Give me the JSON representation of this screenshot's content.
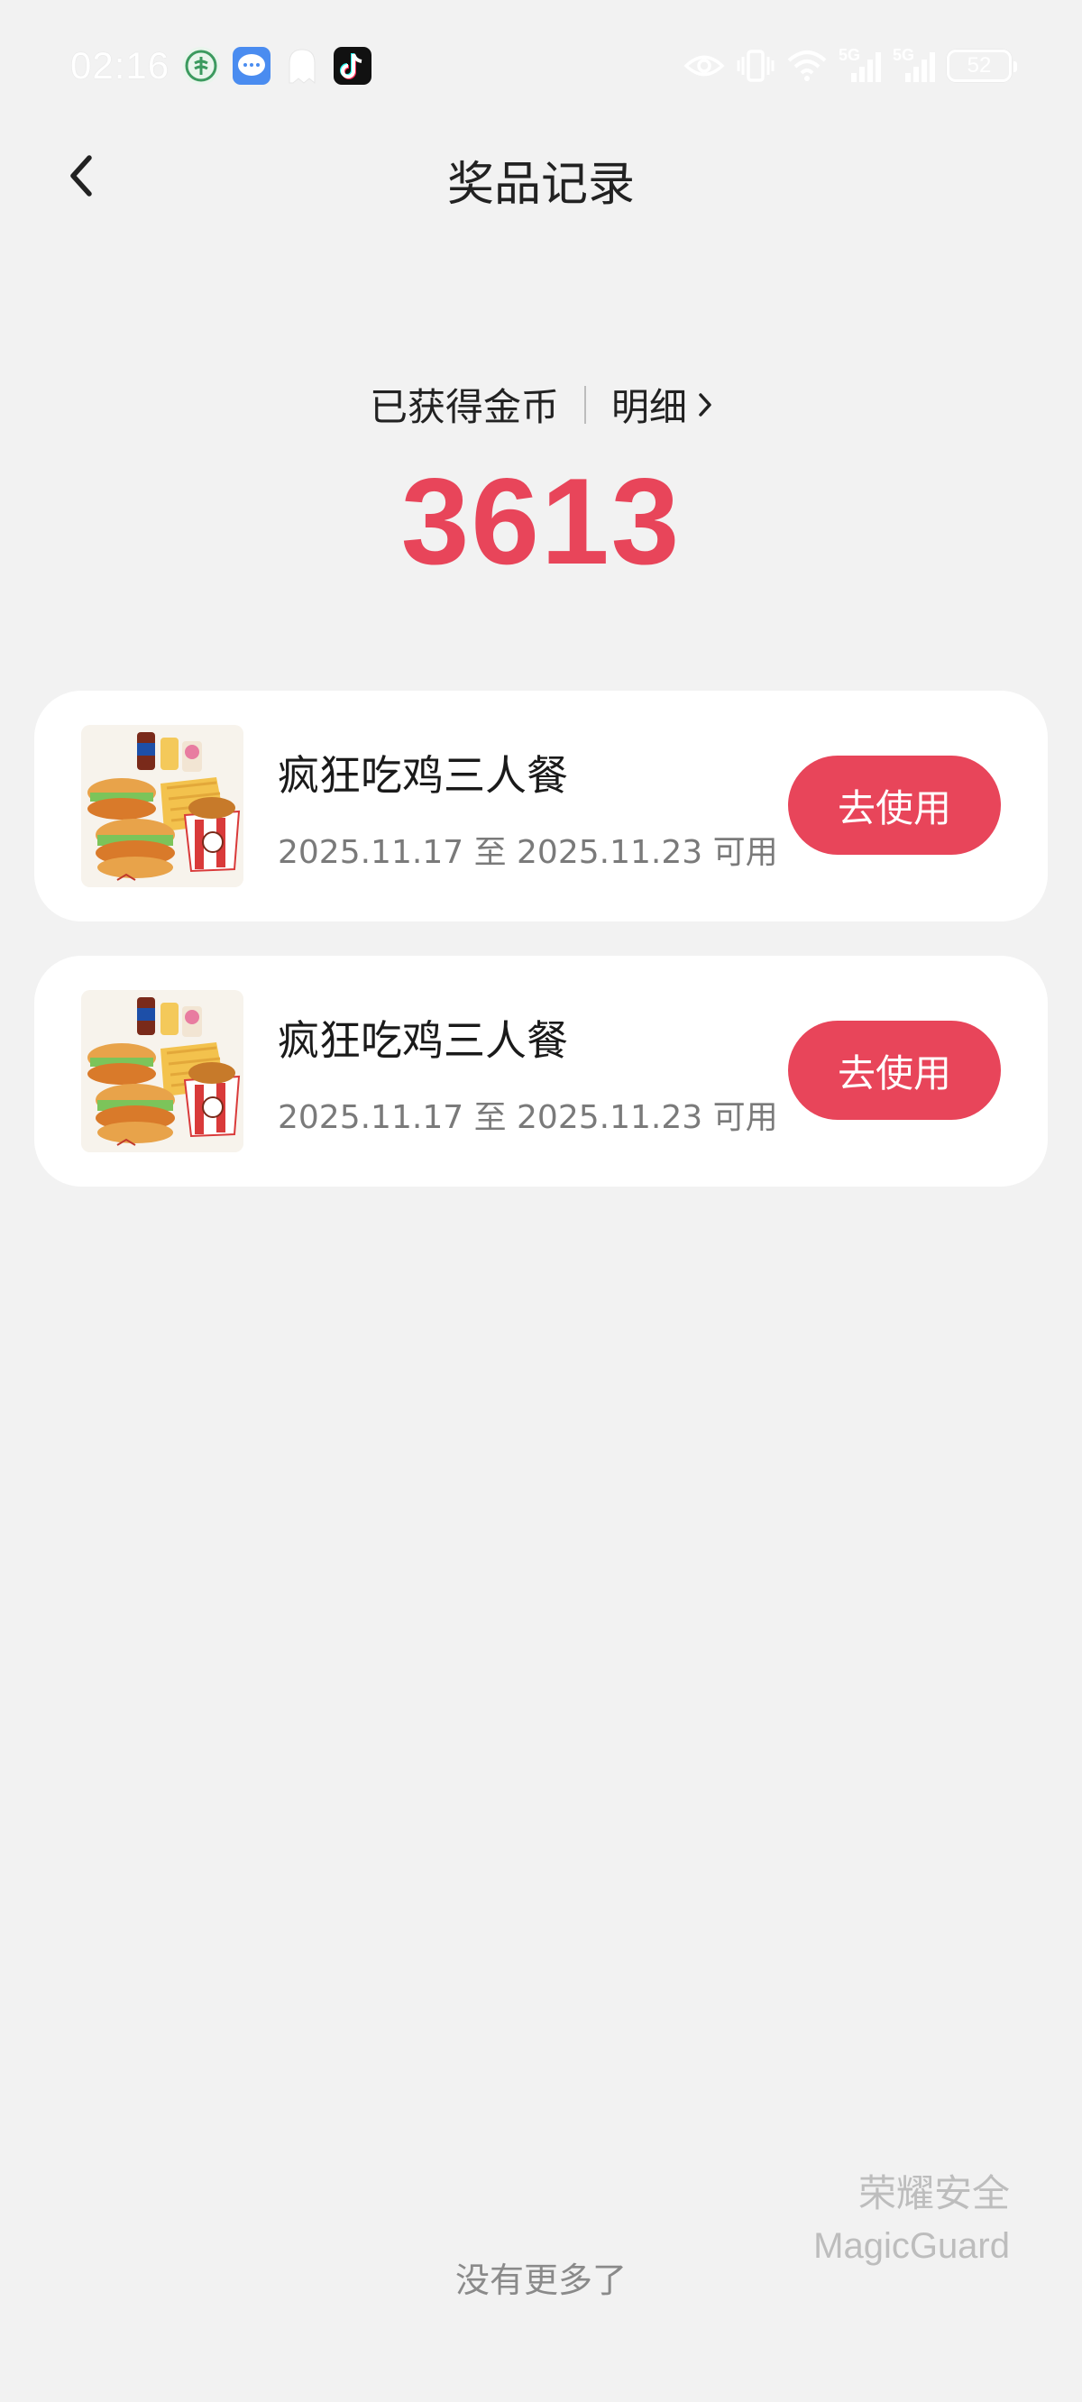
{
  "status_bar": {
    "time": "02:16",
    "battery": "52",
    "network_label_1": "5G",
    "network_label_2": "5G",
    "icons": [
      "green-leaf-app-icon",
      "chat-bubble-app-icon",
      "ghost-notification-icon",
      "tiktok-icon",
      "eye-icon",
      "vibrate-icon",
      "wifi-icon",
      "signal-5g-icon",
      "signal-5g-icon",
      "battery-icon"
    ]
  },
  "header": {
    "title": "奖品记录",
    "back_icon": "chevron-left-icon"
  },
  "coins": {
    "label": "已获得金币",
    "detail_label": "明细",
    "detail_icon": "chevron-right-icon",
    "value": "3613",
    "accent_color": "#e8455a"
  },
  "prizes": [
    {
      "name": "疯狂吃鸡三人餐",
      "validity": "2025.11.17 至 2025.11.23 可用",
      "button_label": "去使用"
    },
    {
      "name": "疯狂吃鸡三人餐",
      "validity": "2025.11.17 至 2025.11.23 可用",
      "button_label": "去使用"
    }
  ],
  "footer": {
    "no_more": "没有更多了"
  },
  "watermark": {
    "line1": "荣耀安全",
    "line2": "MagicGuard"
  }
}
